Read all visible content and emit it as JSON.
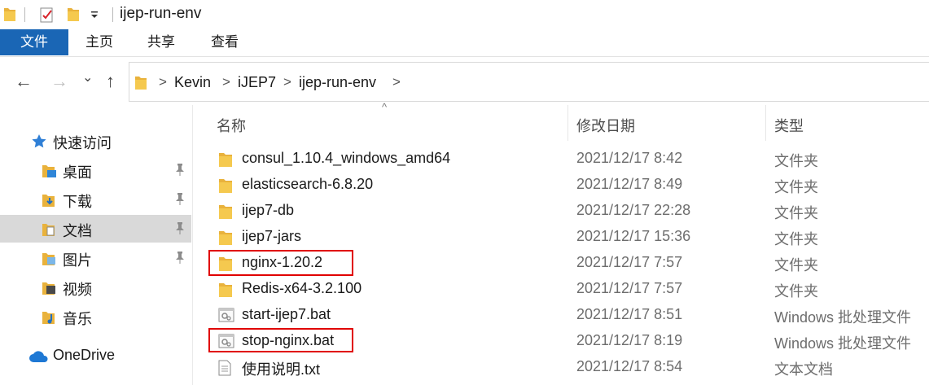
{
  "window": {
    "title": "ijep-run-env"
  },
  "ribbon": {
    "tabs": [
      {
        "label": "文件",
        "active": true
      },
      {
        "label": "主页"
      },
      {
        "label": "共享"
      },
      {
        "label": "查看"
      }
    ]
  },
  "address": {
    "breadcrumb": [
      "Kevin",
      "iJEP7",
      "ijep-run-env"
    ],
    "separator": ">"
  },
  "nav_icons": {
    "back": "←",
    "forward": "→",
    "recent": "⌄",
    "up": "↑"
  },
  "navpane": {
    "quick_access_label": "快速访问",
    "items": [
      {
        "label": "桌面",
        "icon": "desktop-folder-icon",
        "pinned": true
      },
      {
        "label": "下载",
        "icon": "download-folder-icon",
        "pinned": true
      },
      {
        "label": "文档",
        "icon": "documents-folder-icon",
        "pinned": true,
        "selected": true
      },
      {
        "label": "图片",
        "icon": "pictures-folder-icon",
        "pinned": true
      },
      {
        "label": "视频",
        "icon": "videos-folder-icon",
        "pinned": false
      },
      {
        "label": "音乐",
        "icon": "music-folder-icon",
        "pinned": false
      }
    ],
    "onedrive_label": "OneDrive"
  },
  "columns": {
    "name": "名称",
    "modified": "修改日期",
    "type": "类型"
  },
  "files": [
    {
      "name": "consul_1.10.4_windows_amd64",
      "modified": "2021/12/17 8:42",
      "type": "文件夹",
      "kind": "folder"
    },
    {
      "name": "elasticsearch-6.8.20",
      "modified": "2021/12/17 8:49",
      "type": "文件夹",
      "kind": "folder"
    },
    {
      "name": "ijep7-db",
      "modified": "2021/12/17 22:28",
      "type": "文件夹",
      "kind": "folder"
    },
    {
      "name": "ijep7-jars",
      "modified": "2021/12/17 15:36",
      "type": "文件夹",
      "kind": "folder"
    },
    {
      "name": "nginx-1.20.2",
      "modified": "2021/12/17 7:57",
      "type": "文件夹",
      "kind": "folder",
      "highlighted": true
    },
    {
      "name": "Redis-x64-3.2.100",
      "modified": "2021/12/17 7:57",
      "type": "文件夹",
      "kind": "folder"
    },
    {
      "name": "start-ijep7.bat",
      "modified": "2021/12/17 8:51",
      "type": "Windows 批处理文件",
      "kind": "bat"
    },
    {
      "name": "stop-nginx.bat",
      "modified": "2021/12/17 8:19",
      "type": "Windows 批处理文件",
      "kind": "bat",
      "highlighted": true
    },
    {
      "name": "使用说明.txt",
      "modified": "2021/12/17 8:54",
      "type": "文本文档",
      "kind": "txt"
    }
  ],
  "colors": {
    "accent": "#1a66b5",
    "folder": "#f2c14e",
    "highlight": "#e00000",
    "selected_bg": "#d9d9d9"
  }
}
